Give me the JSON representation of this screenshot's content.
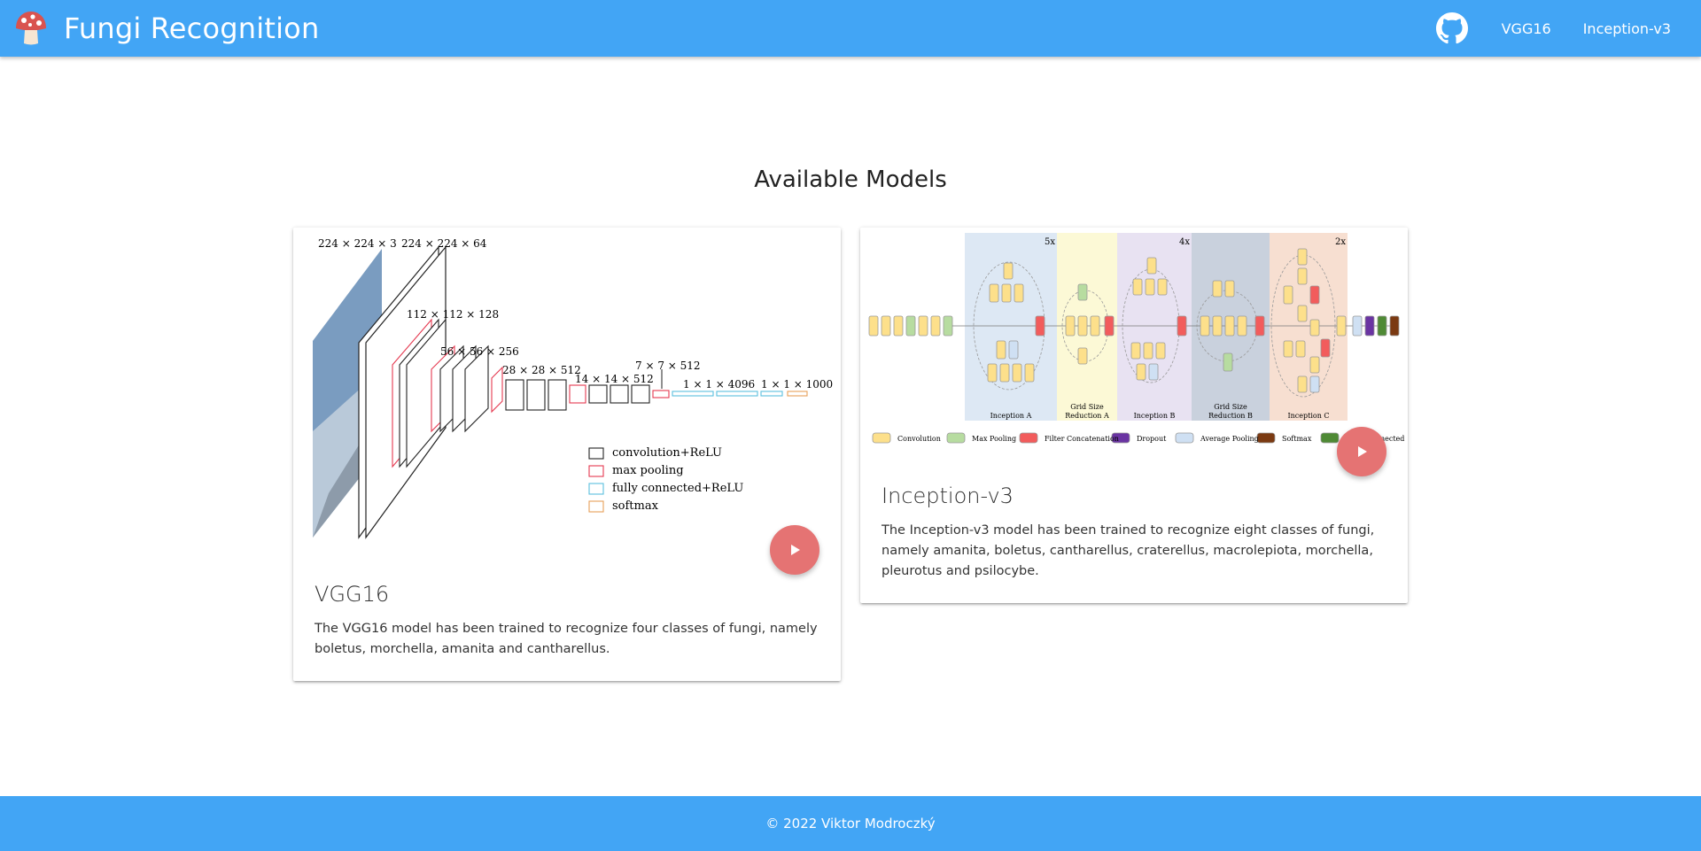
{
  "nav": {
    "title": "Fungi Recognition",
    "logo_icon": "mushroom-icon",
    "github_icon": "github-icon",
    "links": [
      "VGG16",
      "Inception-v3"
    ]
  },
  "main": {
    "section_title": "Available Models",
    "cards": [
      {
        "title": "VGG16",
        "description": "The VGG16 model has been trained to recognize four classes of fungi, namely boletus, morchella, amanita and cantharellus.",
        "action_icon": "play-icon",
        "diagram": {
          "dims": [
            "224 × 224 × 3",
            "224 × 224 × 64",
            "112 × 112 × 128",
            "56 × 56 × 256",
            "28 × 28 × 512",
            "14 × 14 × 512",
            "7 × 7 × 512",
            "1 × 1 × 4096",
            "1 × 1 × 1000"
          ],
          "legend": [
            "convolution+ReLU",
            "max pooling",
            "fully connected+ReLU",
            "softmax"
          ]
        }
      },
      {
        "title": "Inception-v3",
        "description": "The Inception-v3 model has been trained to recognize eight classes of fungi, namely amanita, boletus, cantharellus, craterellus, macrolepiota, morchella, pleurotus and psilocybe.",
        "action_icon": "play-icon",
        "diagram": {
          "repeats": [
            "5x",
            "4x",
            "2x"
          ],
          "blocks": [
            "Inception A",
            "Grid Size Reduction A",
            "Inception B",
            "Grid Size Reduction B",
            "Inception C"
          ],
          "legend": [
            "Convolution",
            "Max Pooling",
            "Filter Concatenation",
            "Dropout",
            "Average Pooling",
            "Softmax",
            "Fully Connected"
          ]
        }
      }
    ]
  },
  "footer": {
    "text": "© 2022 Viktor Modroczký"
  },
  "colors": {
    "primary": "#42a5f5",
    "fab": "#e57373"
  }
}
